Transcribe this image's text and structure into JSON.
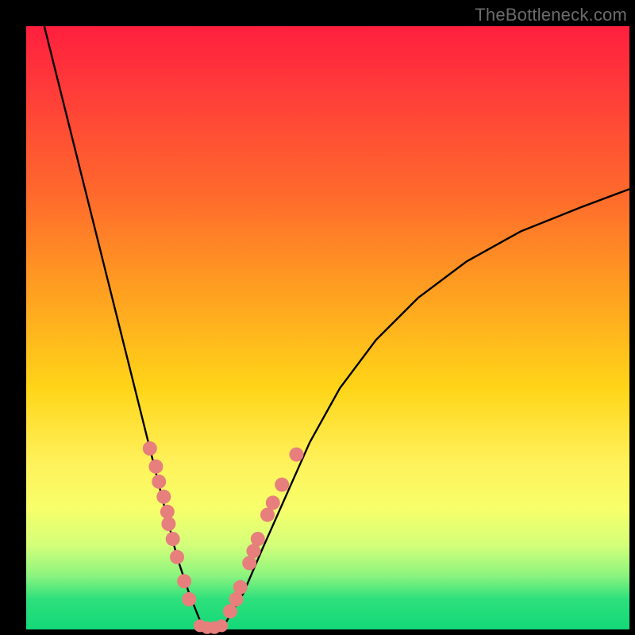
{
  "watermark": "TheBottleneck.com",
  "colors": {
    "background": "#000000",
    "curve_stroke": "#000000",
    "dot_fill": "#e77f7d",
    "gradient_top": "#ff1f3e",
    "gradient_bottom": "#14d878"
  },
  "chart_data": {
    "type": "line",
    "title": "",
    "xlabel": "",
    "ylabel": "",
    "xlim": [
      0,
      100
    ],
    "ylim": [
      0,
      100
    ],
    "series": [
      {
        "name": "bottleneck-curve",
        "x": [
          3,
          5,
          7,
          9,
          11,
          13,
          15,
          17,
          19,
          21,
          23,
          25,
          27,
          29,
          30.5,
          33,
          36,
          39,
          43,
          47,
          52,
          58,
          65,
          73,
          82,
          92,
          100
        ],
        "y": [
          100,
          92,
          84,
          76,
          68,
          60,
          52,
          44,
          36,
          28,
          20,
          12,
          6,
          1,
          0,
          1,
          6,
          13,
          22,
          31,
          40,
          48,
          55,
          61,
          66,
          70,
          73
        ]
      }
    ],
    "markers": [
      {
        "name": "left-arm-dots",
        "points": [
          {
            "x": 20.5,
            "y": 30
          },
          {
            "x": 21.5,
            "y": 27
          },
          {
            "x": 22.0,
            "y": 24.5
          },
          {
            "x": 22.8,
            "y": 22
          },
          {
            "x": 23.4,
            "y": 19.5
          },
          {
            "x": 23.6,
            "y": 17.5
          },
          {
            "x": 24.3,
            "y": 15
          },
          {
            "x": 25.0,
            "y": 12
          },
          {
            "x": 26.2,
            "y": 8
          },
          {
            "x": 27.0,
            "y": 5
          }
        ]
      },
      {
        "name": "valley-dots",
        "points": [
          {
            "x": 28.8,
            "y": 0.6
          },
          {
            "x": 30.0,
            "y": 0.3
          },
          {
            "x": 31.2,
            "y": 0.3
          },
          {
            "x": 32.4,
            "y": 0.6
          }
        ]
      },
      {
        "name": "right-arm-dots",
        "points": [
          {
            "x": 33.8,
            "y": 3
          },
          {
            "x": 34.8,
            "y": 5
          },
          {
            "x": 35.5,
            "y": 7
          },
          {
            "x": 37.0,
            "y": 11
          },
          {
            "x": 37.7,
            "y": 13
          },
          {
            "x": 38.4,
            "y": 15
          },
          {
            "x": 40.0,
            "y": 19
          },
          {
            "x": 40.9,
            "y": 21
          },
          {
            "x": 42.4,
            "y": 24
          },
          {
            "x": 44.8,
            "y": 29
          }
        ]
      }
    ]
  }
}
